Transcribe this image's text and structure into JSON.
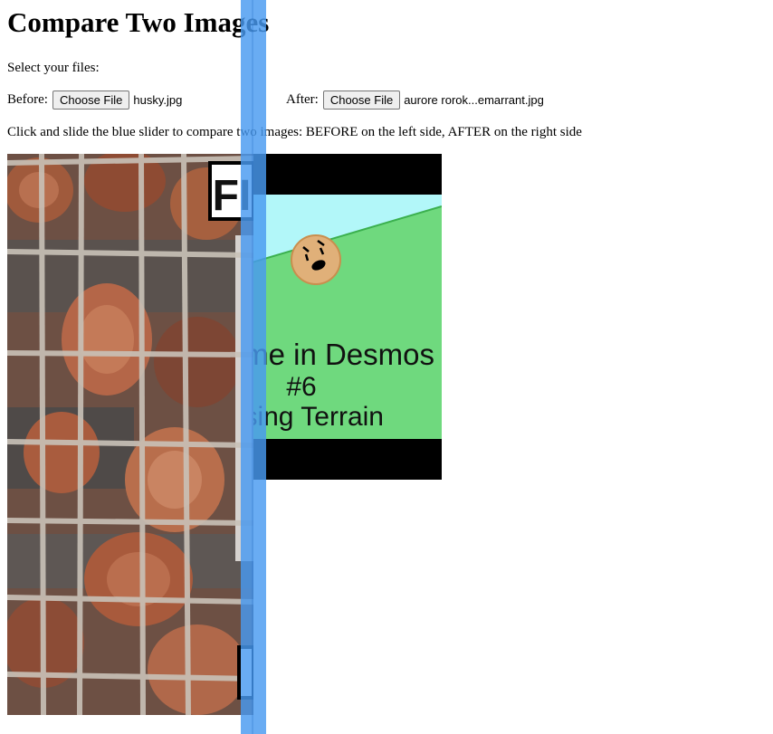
{
  "page": {
    "title": "Compare Two Images",
    "select_prompt": "Select your files:",
    "instructions": "Click and slide the blue slider to compare two images: BEFORE on the left side, AFTER on the right side"
  },
  "before": {
    "label": "Before:",
    "button_label": "Choose File",
    "file_name": "husky.jpg"
  },
  "after": {
    "label": "After:",
    "button_label": "Choose File",
    "file_name": "aurore rorok...emarrant.jpg"
  },
  "after_image": {
    "line1": "Game in Desmos",
    "line2": "#6",
    "line3": "rsing Terrain"
  },
  "before_image": {
    "corner_text": "FI"
  },
  "colors": {
    "slider": "#4a9af0",
    "sky": "#b2f7f9",
    "ground": "#6fd97e"
  }
}
